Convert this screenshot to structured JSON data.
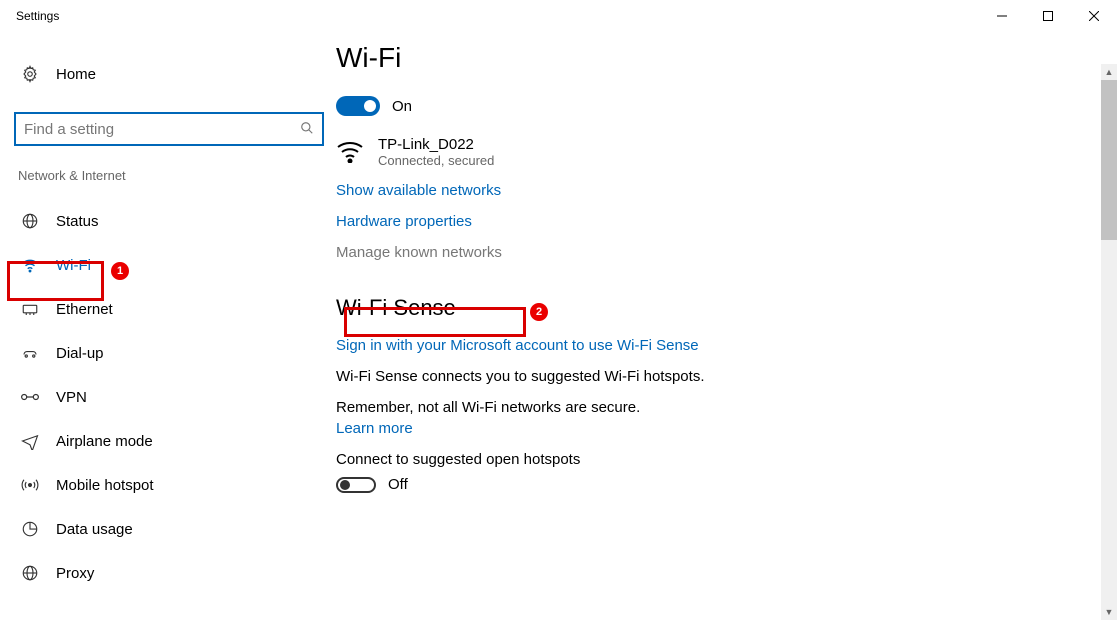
{
  "window": {
    "title": "Settings"
  },
  "sidebar": {
    "home": "Home",
    "search_placeholder": "Find a setting",
    "section": "Network & Internet",
    "items": [
      {
        "label": "Status"
      },
      {
        "label": "Wi-Fi",
        "selected": true
      },
      {
        "label": "Ethernet"
      },
      {
        "label": "Dial-up"
      },
      {
        "label": "VPN"
      },
      {
        "label": "Airplane mode"
      },
      {
        "label": "Mobile hotspot"
      },
      {
        "label": "Data usage"
      },
      {
        "label": "Proxy"
      }
    ]
  },
  "main": {
    "title": "Wi-Fi",
    "wifi_toggle_state": "On",
    "network": {
      "name": "TP-Link_D022",
      "status": "Connected, secured"
    },
    "links": {
      "show_available": "Show available networks",
      "hardware_properties": "Hardware properties",
      "manage_known": "Manage known networks"
    },
    "sense": {
      "heading": "Wi-Fi Sense",
      "signin_link": "Sign in with your Microsoft account to use Wi-Fi Sense",
      "desc": "Wi-Fi Sense connects you to suggested Wi-Fi hotspots.",
      "remember": "Remember, not all Wi-Fi networks are secure.",
      "learn_more": "Learn more",
      "connect_suggested": "Connect to suggested open hotspots",
      "suggested_toggle_state": "Off"
    }
  },
  "annotations": {
    "badge1": "1",
    "badge2": "2"
  }
}
